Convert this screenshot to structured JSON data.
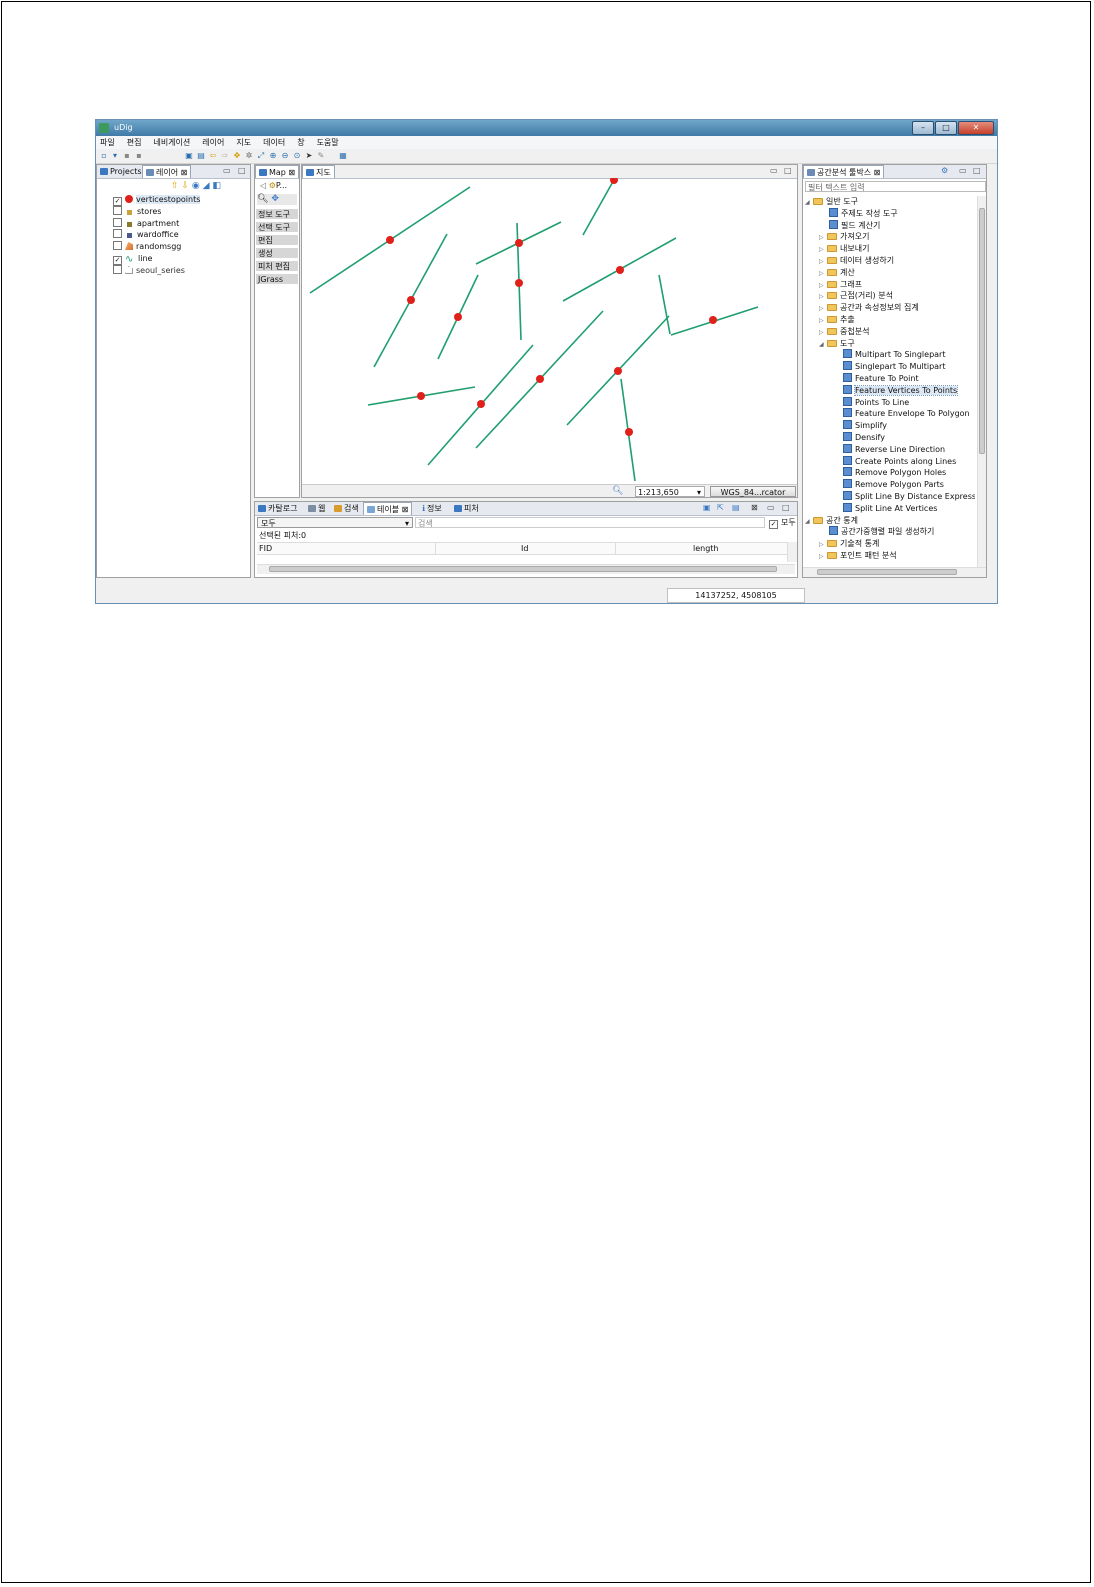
{
  "window": {
    "title": "uDig"
  },
  "menu": [
    "파일",
    "편집",
    "네비게이션",
    "레이어",
    "지도",
    "데이터",
    "창",
    "도움말"
  ],
  "layers_panel": {
    "tabs": [
      "Projects",
      "레이어"
    ],
    "layers": [
      {
        "name": "verticestopoints",
        "checked": true,
        "icon": "red-point-icon"
      },
      {
        "name": "stores",
        "checked": false,
        "icon": "point-icon"
      },
      {
        "name": "apartment",
        "checked": false,
        "icon": "point-icon"
      },
      {
        "name": "wardoffice",
        "checked": false,
        "icon": "point-icon"
      },
      {
        "name": "randomsgg",
        "checked": false,
        "icon": "polygon-icon"
      },
      {
        "name": "line",
        "checked": true,
        "icon": "line-icon"
      },
      {
        "name": "seoul_series",
        "checked": false,
        "icon": "polygon-icon"
      }
    ]
  },
  "palette": {
    "tab": "Map",
    "subtab": "P...",
    "categories": [
      "정보 도구",
      "선택 도구",
      "편집",
      "생성",
      "피처 편집",
      "JGrass"
    ]
  },
  "map": {
    "tab": "지도",
    "scale": "1:213,650",
    "crs": "WGS_84...rcator",
    "line_color": "#1f9e6e",
    "point_color": "#e0201a"
  },
  "toolbox": {
    "tab": "공간분석 툴박스",
    "filter_placeholder": "필터 텍스트 입력",
    "tree": [
      {
        "label": "일반 도구",
        "type": "folder",
        "level": 0,
        "open": true
      },
      {
        "label": "주제도 작성 도구",
        "type": "tool",
        "level": 1
      },
      {
        "label": "필드 계산기",
        "type": "tool",
        "level": 1
      },
      {
        "label": "가져오기",
        "type": "folder",
        "level": 1,
        "open": false
      },
      {
        "label": "내보내기",
        "type": "folder",
        "level": 1,
        "open": false
      },
      {
        "label": "데이터 생성하기",
        "type": "folder",
        "level": 1,
        "open": false
      },
      {
        "label": "계산",
        "type": "folder",
        "level": 1,
        "open": false
      },
      {
        "label": "그래프",
        "type": "folder",
        "level": 1,
        "open": false
      },
      {
        "label": "근접(거리) 분석",
        "type": "folder",
        "level": 1,
        "open": false
      },
      {
        "label": "공간과 속성정보의 집계",
        "type": "folder",
        "level": 1,
        "open": false
      },
      {
        "label": "추출",
        "type": "folder",
        "level": 1,
        "open": false
      },
      {
        "label": "중첩분석",
        "type": "folder",
        "level": 1,
        "open": false
      },
      {
        "label": "도구",
        "type": "folder",
        "level": 1,
        "open": true
      },
      {
        "label": "Multipart To Singlepart",
        "type": "tool",
        "level": 2
      },
      {
        "label": "Singlepart To Multipart",
        "type": "tool",
        "level": 2
      },
      {
        "label": "Feature To Point",
        "type": "tool",
        "level": 2
      },
      {
        "label": "Feature Vertices To Points",
        "type": "tool",
        "level": 2,
        "selected": true
      },
      {
        "label": "Points To Line",
        "type": "tool",
        "level": 2
      },
      {
        "label": "Feature Envelope To Polygon",
        "type": "tool",
        "level": 2
      },
      {
        "label": "Simplify",
        "type": "tool",
        "level": 2
      },
      {
        "label": "Densify",
        "type": "tool",
        "level": 2
      },
      {
        "label": "Reverse Line Direction",
        "type": "tool",
        "level": 2
      },
      {
        "label": "Create Points along Lines",
        "type": "tool",
        "level": 2
      },
      {
        "label": "Remove Polygon Holes",
        "type": "tool",
        "level": 2
      },
      {
        "label": "Remove Polygon Parts",
        "type": "tool",
        "level": 2
      },
      {
        "label": "Split Line By Distance Expression",
        "type": "tool",
        "level": 2
      },
      {
        "label": "Split Line At Vertices",
        "type": "tool",
        "level": 2
      },
      {
        "label": "공간 통계",
        "type": "folder",
        "level": 0,
        "open": true
      },
      {
        "label": "공간가중행렬 파일 생성하기",
        "type": "tool",
        "level": 1
      },
      {
        "label": "기술적 통계",
        "type": "folder",
        "level": 1,
        "open": false
      },
      {
        "label": "포인트 패턴 분석",
        "type": "folder",
        "level": 1,
        "open": false
      }
    ]
  },
  "bottom_panel": {
    "tabs": [
      "카탈로그",
      "웹",
      "검색",
      "테이블",
      "정보",
      "피처"
    ],
    "filter_select": "모두",
    "search_placeholder": "검색",
    "all_checkbox": "모두",
    "selected_features": "선택된 피처:0",
    "columns": [
      "FID",
      "Id",
      "length"
    ]
  },
  "statusbar": {
    "coords": "14137252, 4508105"
  }
}
